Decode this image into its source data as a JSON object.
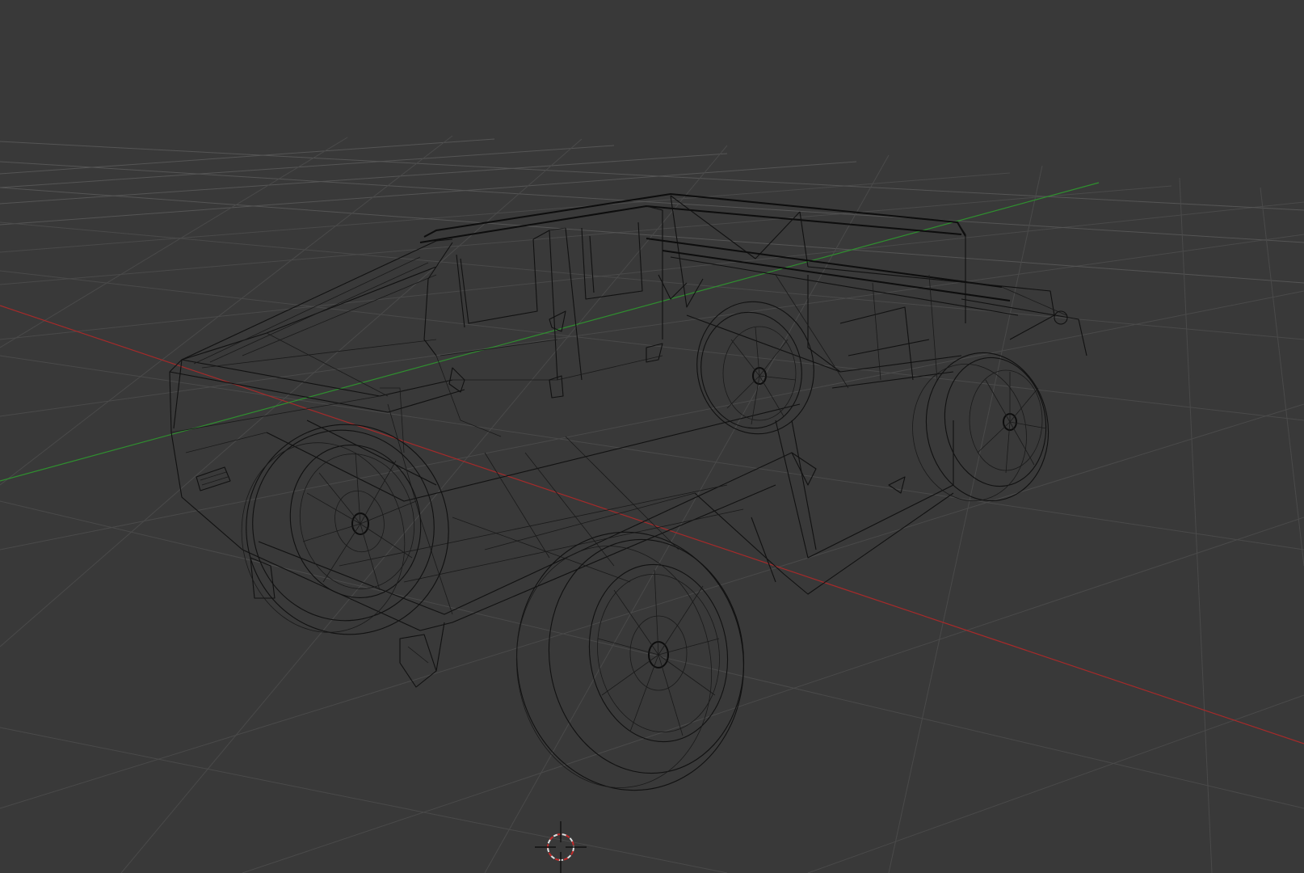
{
  "viewport": {
    "background_color": "#393939",
    "grid_color": "#4a4a4a",
    "x_axis_color": "#a52a2a",
    "y_axis_color": "#2f8f2f",
    "wireframe_color": "#111111",
    "shading_mode": "wireframe"
  },
  "scene": {
    "object": "humvee-vehicle-wireframe",
    "cursor": "3d-cursor-icon"
  }
}
